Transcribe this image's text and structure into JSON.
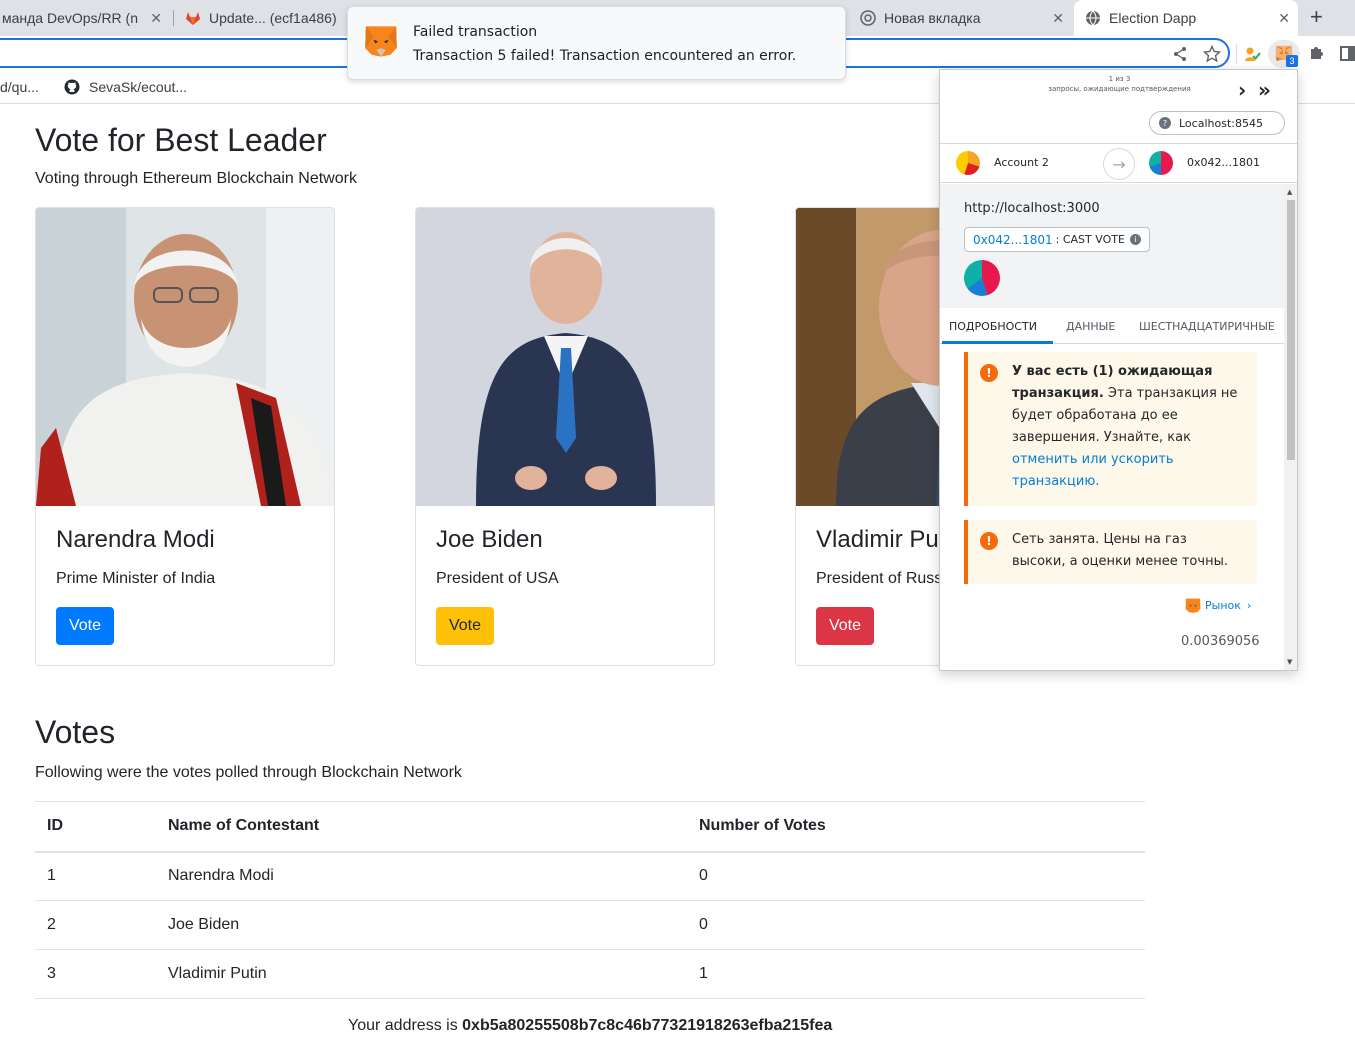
{
  "browser": {
    "tabs": [
      {
        "label": "манда DevOps/RR (n",
        "active": false
      },
      {
        "label": "Update... (ecf1a486)",
        "active": false
      },
      {
        "label": "Новая вкладка",
        "active": false
      },
      {
        "label": "Election Dapp",
        "active": true
      }
    ],
    "new_tab": "+",
    "close": "✕",
    "bookmarks": [
      {
        "label": "d/qu..."
      },
      {
        "label": "SevaSk/ecout..."
      }
    ],
    "extension_badge": "3"
  },
  "notification": {
    "title": "Failed transaction",
    "message": "Transaction 5 failed! Transaction encountered an error."
  },
  "page": {
    "title": "Vote for Best Leader",
    "subtitle": "Voting through Ethereum Blockchain Network",
    "candidates": [
      {
        "name": "Narendra Modi",
        "role": "Prime Minister of India",
        "button": "Vote",
        "button_color": "#007bff"
      },
      {
        "name": "Joe Biden",
        "role": "President of USA",
        "button": "Vote",
        "button_color": "#ffc107"
      },
      {
        "name": "Vladimir Putin",
        "role": "President of Russia",
        "button": "Vote",
        "button_color": "#dc3545"
      }
    ],
    "votes_title": "Votes",
    "votes_subtitle": "Following were the votes polled through Blockchain Network",
    "table": {
      "headers": [
        "ID",
        "Name of Contestant",
        "Number of Votes"
      ],
      "rows": [
        [
          "1",
          "Narendra Modi",
          "0"
        ],
        [
          "2",
          "Joe Biden",
          "0"
        ],
        [
          "3",
          "Vladimir Putin",
          "1"
        ]
      ]
    },
    "address_prefix": "Your address is ",
    "address": "0xb5a80255508b7c8c46b77321918263efba215fea"
  },
  "metamask": {
    "queue_count": "1 из 3",
    "queue_text": "запросы, ожидающие подтверждения",
    "network": "Localhost:8545",
    "from_account": "Account 2",
    "to_account": "0x042...1801",
    "origin": "http://localhost:3000",
    "method_address": "0x042...1801",
    "method_name": ": CAST VOTE",
    "tabs": [
      "ПОДРОБНОСТИ",
      "ДАННЫЕ",
      "ШЕСТНАДЦАТИРИЧНЫЕ"
    ],
    "alert1": {
      "bold": "У вас есть (1) ожидающая транзакция.",
      "text": " Эта транзакция не будет обработана до ее завершения. Узнайте, как ",
      "link": "отменить или ускорить транзакцию."
    },
    "alert2": {
      "text": "Сеть занята. Цены на газ высоки, а оценки менее точны."
    },
    "market_label": "Рынок",
    "gas_value": "0.00369056"
  }
}
